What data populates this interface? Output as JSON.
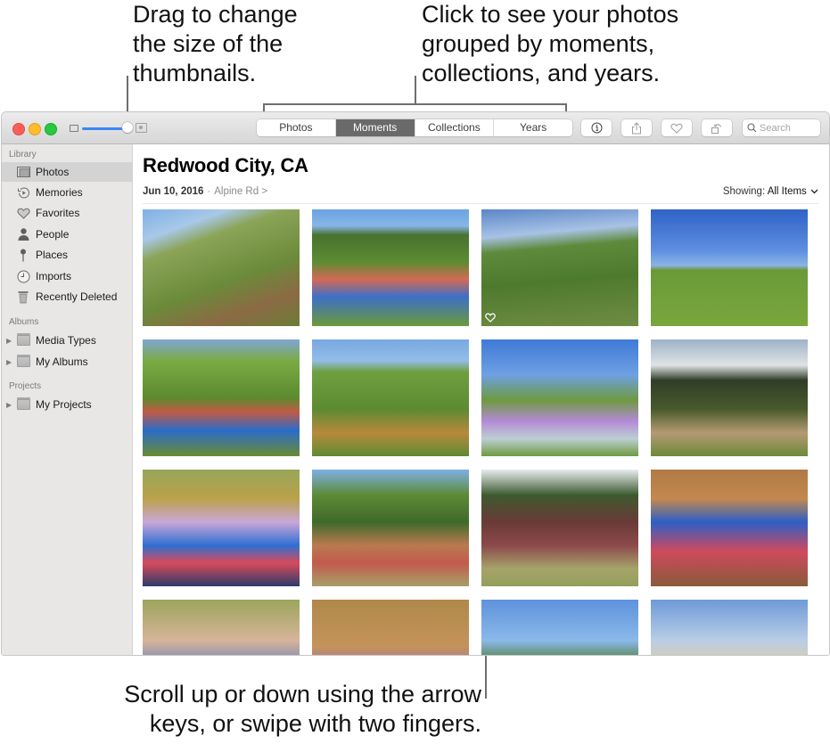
{
  "callouts": {
    "slider": [
      "Drag to change",
      "the size of the",
      "thumbnails."
    ],
    "views": [
      "Click to see your photos",
      "grouped by moments,",
      "collections, and years."
    ],
    "scroll": [
      "Scroll up or down using the arrow",
      "keys, or swipe with two fingers."
    ]
  },
  "toolbar": {
    "window_controls": [
      "close",
      "minimize",
      "zoom"
    ],
    "thumbnail_size_slider": {
      "value_percent": 100
    },
    "view_tabs": [
      {
        "label": "Photos",
        "active": false
      },
      {
        "label": "Moments",
        "active": true
      },
      {
        "label": "Collections",
        "active": false
      },
      {
        "label": "Years",
        "active": false
      }
    ],
    "buttons": [
      {
        "name": "info-button",
        "icon": "info-icon"
      },
      {
        "name": "share-button",
        "icon": "share-icon"
      },
      {
        "name": "favorite-button",
        "icon": "heart-icon"
      },
      {
        "name": "rotate-button",
        "icon": "rotate-icon"
      }
    ],
    "search_placeholder": "Search"
  },
  "sidebar": {
    "library_heading": "Library",
    "library_items": [
      {
        "label": "Photos",
        "icon": "photos-icon",
        "selected": true
      },
      {
        "label": "Memories",
        "icon": "memories-icon",
        "selected": false
      },
      {
        "label": "Favorites",
        "icon": "heart-icon",
        "selected": false
      },
      {
        "label": "People",
        "icon": "person-icon",
        "selected": false
      },
      {
        "label": "Places",
        "icon": "pin-icon",
        "selected": false
      },
      {
        "label": "Imports",
        "icon": "clock-icon",
        "selected": false
      },
      {
        "label": "Recently Deleted",
        "icon": "trash-icon",
        "selected": false
      }
    ],
    "albums_heading": "Albums",
    "album_items": [
      {
        "label": "Media Types"
      },
      {
        "label": "My Albums"
      }
    ],
    "projects_heading": "Projects",
    "project_items": [
      {
        "label": "My Projects"
      }
    ]
  },
  "main": {
    "title": "Redwood City, CA",
    "date": "Jun 10, 2016",
    "separator": "·",
    "place": "Alpine Rd",
    "place_chevron": ">",
    "showing_label": "Showing:",
    "showing_value": "All Items",
    "photos": [
      {
        "desc": "grassy trail with orange poppies",
        "favorite": false
      },
      {
        "desc": "couple embracing in meadow",
        "favorite": false
      },
      {
        "desc": "girl with backpack on hillside",
        "favorite": true
      },
      {
        "desc": "hikers on distant green hill",
        "favorite": false
      },
      {
        "desc": "kids walking up grassy slope",
        "favorite": false
      },
      {
        "desc": "girls hiking on green hill",
        "favorite": false
      },
      {
        "desc": "smiling girl in purple jacket",
        "favorite": false
      },
      {
        "desc": "hikers on dirt path at dusk",
        "favorite": false
      },
      {
        "desc": "family sitting in grass",
        "favorite": false
      },
      {
        "desc": "curly-haired boy on hillside",
        "favorite": false
      },
      {
        "desc": "kids in tall grass",
        "favorite": false
      },
      {
        "desc": "kids close-up selfie",
        "favorite": false
      },
      {
        "desc": "man smiling selfie",
        "favorite": false
      },
      {
        "desc": "curly-haired boy close-up",
        "favorite": false
      },
      {
        "desc": "trees on green hilltop",
        "favorite": false
      },
      {
        "desc": "man and child by the bay",
        "favorite": false
      }
    ]
  }
}
